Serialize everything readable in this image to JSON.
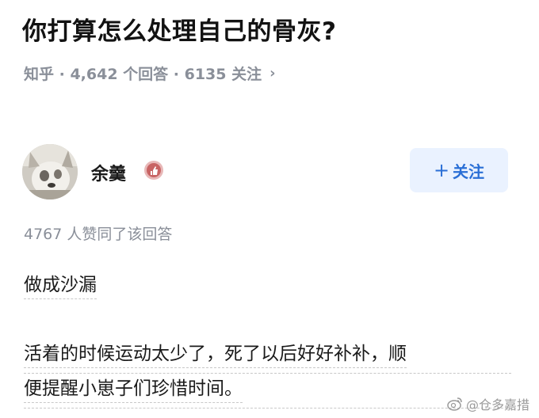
{
  "question": {
    "title": "你打算怎么处理自己的骨灰?",
    "meta": "知乎 · 4,642 个回答 · 6135 关注",
    "chevron": "›"
  },
  "author": {
    "name": "余羹",
    "avatar_icon": "avatar-photo",
    "badge_icon": "certified-badge-icon",
    "badge_color": "#c86464"
  },
  "follow_button": {
    "plus": "+",
    "label": "关注",
    "text_color": "#2a6fd6",
    "background": "#eaf2ff"
  },
  "upvote_text": "4767 人赞同了该回答",
  "answer": {
    "paragraph1": "做成沙漏",
    "paragraph2_lines": [
      "活着的时候运动太少了，死了以后好好补补，顺",
      "便提醒小崽子们珍惜时间。"
    ]
  },
  "watermark": {
    "icon": "weibo-icon",
    "text": "@仓多嘉措"
  }
}
